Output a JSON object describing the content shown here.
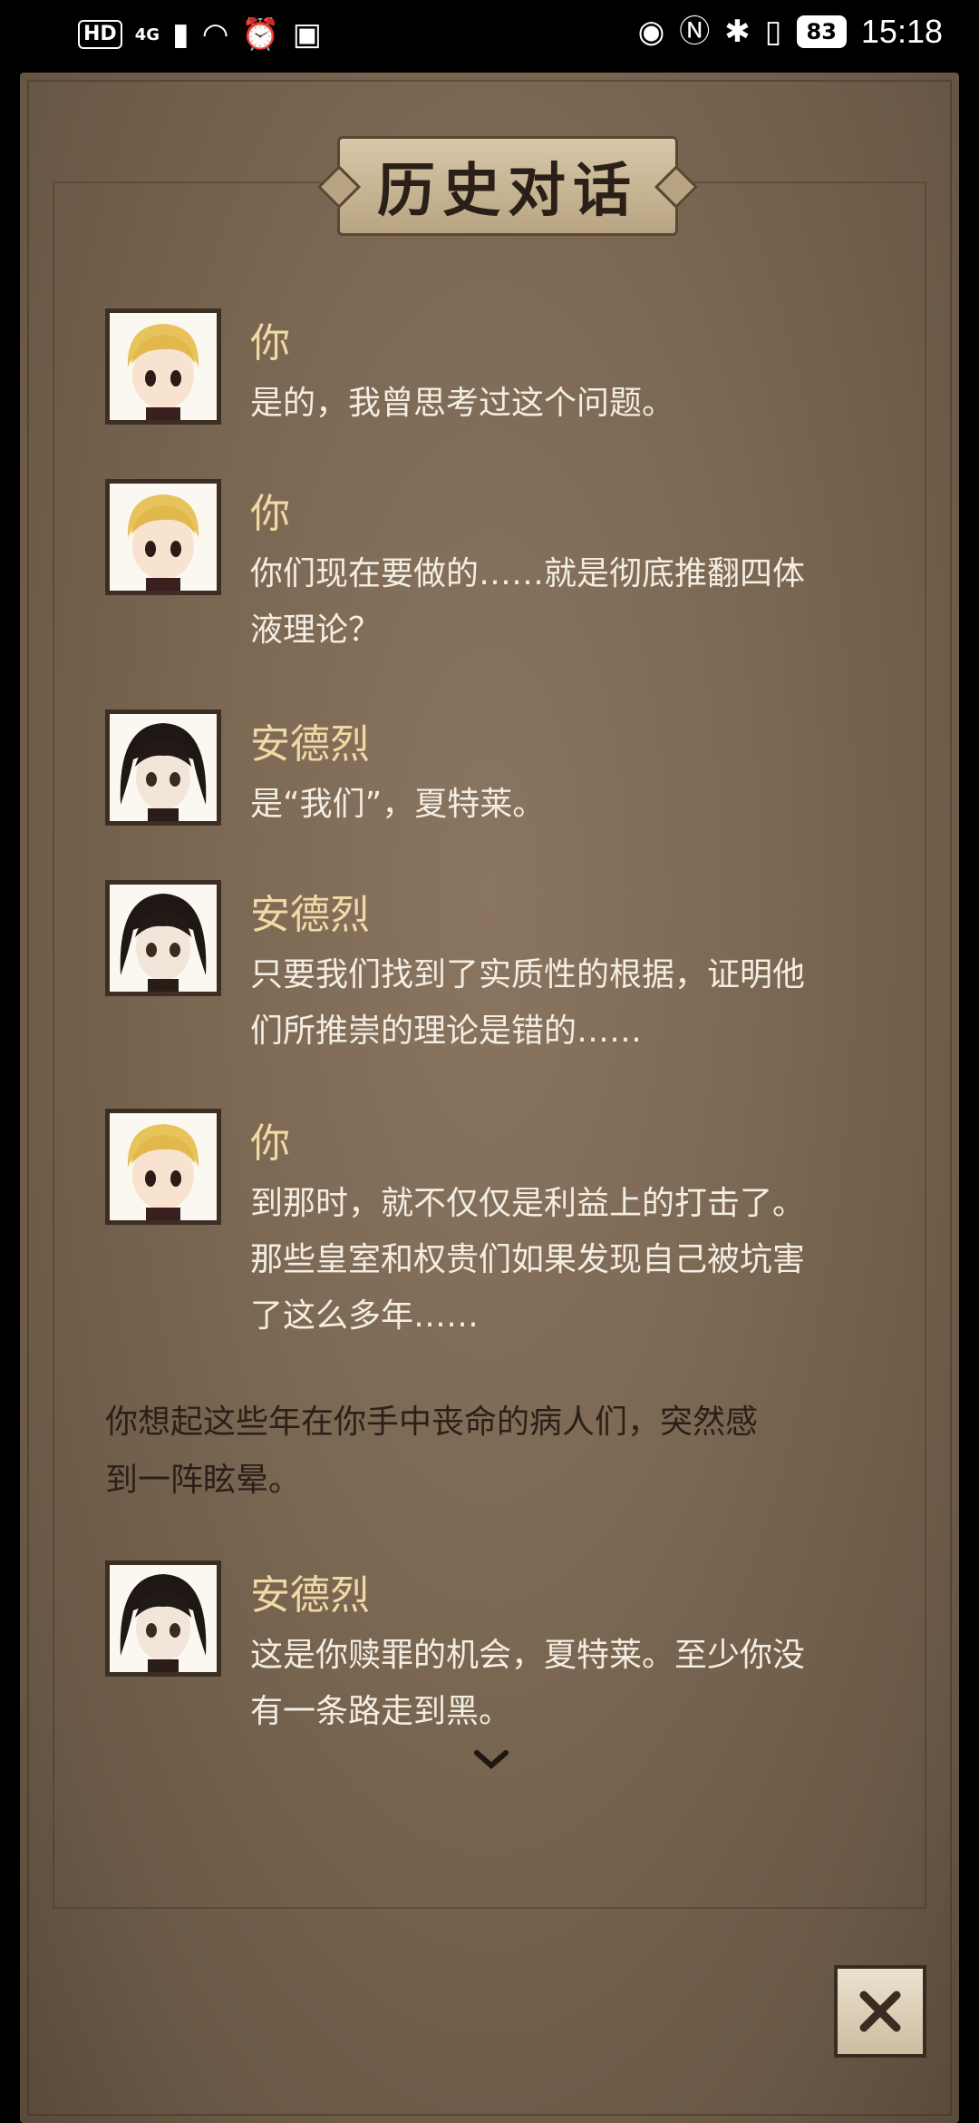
{
  "status_bar": {
    "hd": "HD",
    "network": "4G",
    "battery": "83",
    "time": "15:18"
  },
  "title": "历史对话",
  "dialogue": [
    {
      "speaker": "你",
      "avatar": "blonde-boy-avatar",
      "lines": [
        "是的，我曾思考过这个问题。"
      ]
    },
    {
      "speaker": "你",
      "avatar": "blonde-boy-avatar",
      "lines": [
        "你们现在要做的……就是彻底推翻四体",
        "液理论？"
      ]
    },
    {
      "speaker": "安德烈",
      "avatar": "dark-hair-avatar",
      "lines": [
        "是“我们”，夏特莱。"
      ]
    },
    {
      "speaker": "安德烈",
      "avatar": "dark-hair-avatar",
      "lines": [
        "只要我们找到了实质性的根据，证明他",
        "们所推崇的理论是错的……"
      ]
    },
    {
      "speaker": "你",
      "avatar": "blonde-boy-avatar",
      "lines": [
        "到那时，就不仅仅是利益上的打击了。",
        "那些皇室和权贵们如果发现自己被坑害",
        "了这么多年……"
      ]
    }
  ],
  "narration": [
    "你想起这些年在你手中丧命的病人们，突然感",
    "到一阵眩晕。"
  ],
  "last_entry": {
    "speaker": "安德烈",
    "avatar": "dark-hair-avatar",
    "lines": [
      "这是你赎罪的机会，夏特莱。至少你没",
      "有一条路走到黑。"
    ]
  },
  "icons": {
    "more": "chevron-down-icon",
    "close": "close-icon"
  }
}
